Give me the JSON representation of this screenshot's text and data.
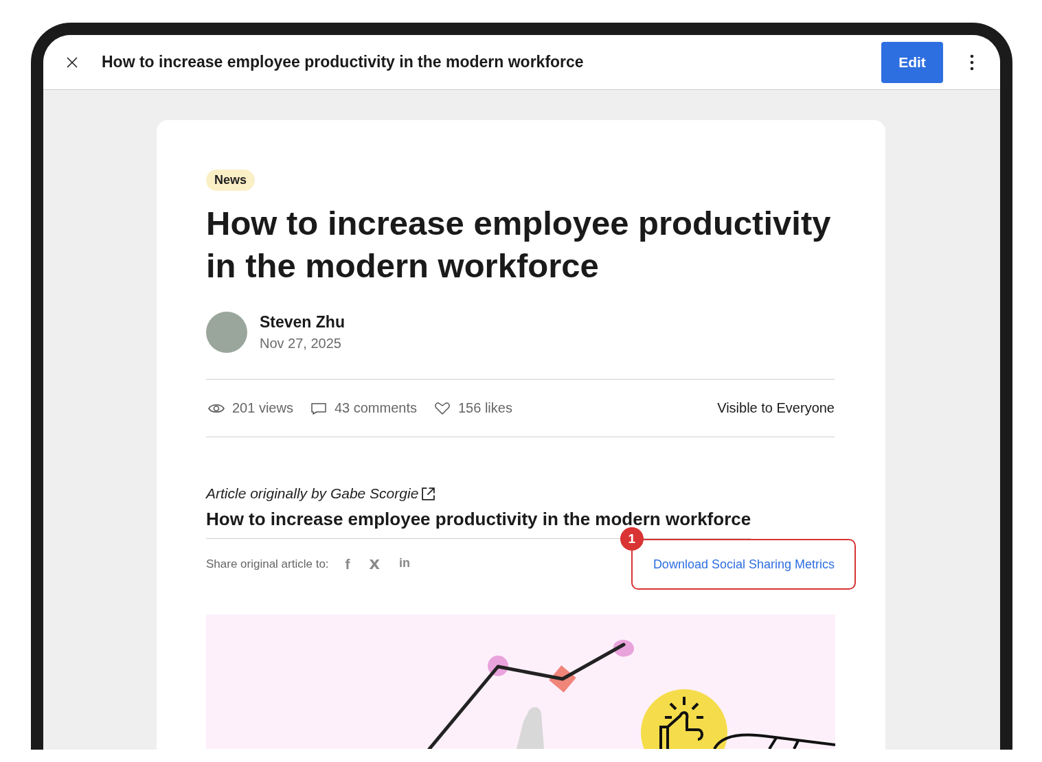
{
  "window": {
    "title": "How to increase employee productivity in the modern workforce",
    "edit_button": "Edit"
  },
  "article": {
    "tag": "News",
    "title": "How to increase employee productivity in the modern workforce",
    "author": {
      "name": "Steven Zhu",
      "date": "Nov 27, 2025"
    },
    "stats": [
      {
        "kind": "views",
        "text": "201 views"
      },
      {
        "kind": "comments",
        "text": "43 comments"
      },
      {
        "kind": "likes",
        "text": "156 likes"
      }
    ],
    "visibility": "Visible to Everyone",
    "source": "Article originally by Gabe Scorgie",
    "subtitle": "How to increase employee productivity in the modern workforce",
    "share": {
      "label": "Share original article to:",
      "networks": [
        {
          "kind": "facebook",
          "glyph": "f"
        },
        {
          "kind": "x",
          "glyph": "X"
        },
        {
          "kind": "linkedin",
          "glyph": "in"
        }
      ]
    },
    "download_link": "Download Social Sharing Metrics"
  },
  "callout": {
    "number": "1"
  }
}
